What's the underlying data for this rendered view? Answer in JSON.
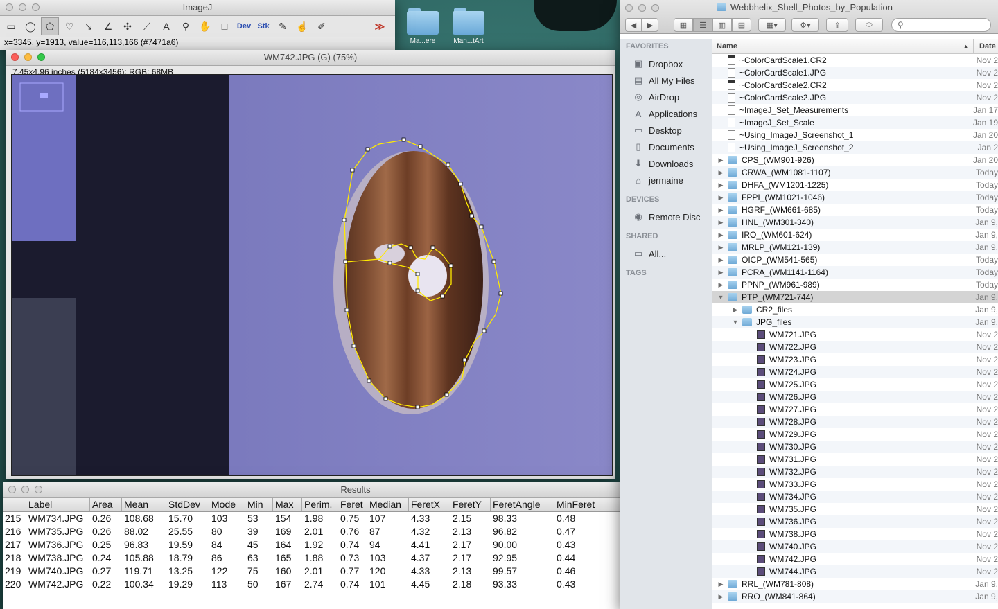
{
  "desktop": {
    "icons": [
      {
        "label": "Ma...ere"
      },
      {
        "label": "Man...tArt"
      }
    ]
  },
  "imagej": {
    "title": "ImageJ",
    "tools": [
      {
        "name": "rectangle-tool-icon",
        "glyph": "▭"
      },
      {
        "name": "oval-tool-icon",
        "glyph": "◯"
      },
      {
        "name": "polygon-tool-icon",
        "glyph": "⬠"
      },
      {
        "name": "freehand-tool-icon",
        "glyph": "♡"
      },
      {
        "name": "line-tool-icon",
        "glyph": "↘"
      },
      {
        "name": "angle-tool-icon",
        "glyph": "∠"
      },
      {
        "name": "point-tool-icon",
        "glyph": "✣"
      },
      {
        "name": "wand-tool-icon",
        "glyph": "⟋"
      },
      {
        "name": "text-tool-icon",
        "glyph": "A"
      },
      {
        "name": "magnifier-tool-icon",
        "glyph": "⚲"
      },
      {
        "name": "hand-tool-icon",
        "glyph": "✋"
      },
      {
        "name": "color-picker-tool-icon",
        "glyph": "□"
      },
      {
        "name": "dev-menu",
        "glyph": "Dev"
      },
      {
        "name": "stk-menu",
        "glyph": "Stk"
      },
      {
        "name": "brush-tool-icon",
        "glyph": "✎"
      },
      {
        "name": "flood-fill-tool-icon",
        "glyph": "☝"
      },
      {
        "name": "pencil-tool-icon",
        "glyph": "✐"
      },
      {
        "name": "blank-tool-1",
        "glyph": ""
      },
      {
        "name": "blank-tool-2",
        "glyph": ""
      },
      {
        "name": "more-tools-icon",
        "glyph": "≫"
      }
    ],
    "status": "x=3345, y=1913, value=116,113,166 (#7471a6)"
  },
  "image_window": {
    "title": "WM742.JPG (G) (75%)",
    "info": "7.45x4.96 inches (5184x3456); RGB; 68MB"
  },
  "results": {
    "title": "Results",
    "columns": [
      "",
      "Label",
      "Area",
      "Mean",
      "StdDev",
      "Mode",
      "Min",
      "Max",
      "Perim.",
      "Feret",
      "Median",
      "FeretX",
      "FeretY",
      "FeretAngle",
      "MinFeret"
    ],
    "rows": [
      [
        "215",
        "WM734.JPG",
        "0.26",
        "108.68",
        "15.70",
        "103",
        "53",
        "154",
        "1.98",
        "0.75",
        "107",
        "4.33",
        "2.15",
        "98.33",
        "0.48"
      ],
      [
        "216",
        "WM735.JPG",
        "0.26",
        "88.02",
        "25.55",
        "80",
        "39",
        "169",
        "2.01",
        "0.76",
        "87",
        "4.32",
        "2.13",
        "96.82",
        "0.47"
      ],
      [
        "217",
        "WM736.JPG",
        "0.25",
        "96.83",
        "19.59",
        "84",
        "45",
        "164",
        "1.92",
        "0.74",
        "94",
        "4.41",
        "2.17",
        "90.00",
        "0.43"
      ],
      [
        "218",
        "WM738.JPG",
        "0.24",
        "105.88",
        "18.79",
        "86",
        "63",
        "165",
        "1.88",
        "0.73",
        "103",
        "4.37",
        "2.17",
        "92.95",
        "0.44"
      ],
      [
        "219",
        "WM740.JPG",
        "0.27",
        "119.71",
        "13.25",
        "122",
        "75",
        "160",
        "2.01",
        "0.77",
        "120",
        "4.33",
        "2.13",
        "99.57",
        "0.46"
      ],
      [
        "220",
        "WM742.JPG",
        "0.22",
        "100.34",
        "19.29",
        "113",
        "50",
        "167",
        "2.74",
        "0.74",
        "101",
        "4.45",
        "2.18",
        "93.33",
        "0.43"
      ]
    ]
  },
  "finder": {
    "title": "Webbhelix_Shell_Photos_by_Population",
    "search_placeholder": "",
    "sidebar": [
      {
        "type": "header",
        "label": "FAVORITES"
      },
      {
        "type": "item",
        "label": "Dropbox",
        "icon": "dropbox-icon",
        "glyph": "▣"
      },
      {
        "type": "item",
        "label": "All My Files",
        "icon": "all-files-icon",
        "glyph": "▤"
      },
      {
        "type": "item",
        "label": "AirDrop",
        "icon": "airdrop-icon",
        "glyph": "◎"
      },
      {
        "type": "item",
        "label": "Applications",
        "icon": "applications-icon",
        "glyph": "A"
      },
      {
        "type": "item",
        "label": "Desktop",
        "icon": "desktop-icon",
        "glyph": "▭"
      },
      {
        "type": "item",
        "label": "Documents",
        "icon": "documents-icon",
        "glyph": "▯"
      },
      {
        "type": "item",
        "label": "Downloads",
        "icon": "downloads-icon",
        "glyph": "⬇"
      },
      {
        "type": "item",
        "label": "jermaine",
        "icon": "home-icon",
        "glyph": "⌂"
      },
      {
        "type": "header",
        "label": "DEVICES"
      },
      {
        "type": "item",
        "label": "Remote Disc",
        "icon": "remote-disc-icon",
        "glyph": "◉"
      },
      {
        "type": "header",
        "label": "SHARED"
      },
      {
        "type": "item",
        "label": "All...",
        "icon": "network-icon",
        "glyph": "▭"
      },
      {
        "type": "header",
        "label": "TAGS"
      }
    ],
    "columns": {
      "name": "Name",
      "date": "Date"
    },
    "rows": [
      {
        "name": "~ColorCardScale1.CR2",
        "date": "Nov 2",
        "kind": "cr2",
        "level": 0,
        "tri": ""
      },
      {
        "name": "~ColorCardScale1.JPG",
        "date": "Nov 2",
        "kind": "doc",
        "level": 0,
        "tri": ""
      },
      {
        "name": "~ColorCardScale2.CR2",
        "date": "Nov 2",
        "kind": "cr2",
        "level": 0,
        "tri": ""
      },
      {
        "name": "~ColorCardScale2.JPG",
        "date": "Nov 2",
        "kind": "doc",
        "level": 0,
        "tri": ""
      },
      {
        "name": "~ImageJ_Set_Measurements",
        "date": "Jan 17",
        "kind": "doc",
        "level": 0,
        "tri": ""
      },
      {
        "name": "~ImageJ_Set_Scale",
        "date": "Jan 19",
        "kind": "doc",
        "level": 0,
        "tri": ""
      },
      {
        "name": "~Using_ImageJ_Screenshot_1",
        "date": "Jan 20",
        "kind": "doc",
        "level": 0,
        "tri": ""
      },
      {
        "name": "~Using_ImageJ_Screenshot_2",
        "date": "Jan 2",
        "kind": "doc",
        "level": 0,
        "tri": ""
      },
      {
        "name": "CPS_(WM901-926)",
        "date": "Jan 20",
        "kind": "folder",
        "level": 0,
        "tri": "▶"
      },
      {
        "name": "CRWA_(WM1081-1107)",
        "date": "Today",
        "kind": "folder",
        "level": 0,
        "tri": "▶"
      },
      {
        "name": "DHFA_(WM1201-1225)",
        "date": "Today",
        "kind": "folder",
        "level": 0,
        "tri": "▶"
      },
      {
        "name": "FPPI_(WM1021-1046)",
        "date": "Today",
        "kind": "folder",
        "level": 0,
        "tri": "▶"
      },
      {
        "name": "HGRF_(WM661-685)",
        "date": "Today",
        "kind": "folder",
        "level": 0,
        "tri": "▶"
      },
      {
        "name": "HNL_(WM301-340)",
        "date": "Jan 9,",
        "kind": "folder",
        "level": 0,
        "tri": "▶"
      },
      {
        "name": "IRO_(WM601-624)",
        "date": "Jan 9,",
        "kind": "folder",
        "level": 0,
        "tri": "▶"
      },
      {
        "name": "MRLP_(WM121-139)",
        "date": "Jan 9,",
        "kind": "folder",
        "level": 0,
        "tri": "▶"
      },
      {
        "name": "OICP_(WM541-565)",
        "date": "Today",
        "kind": "folder",
        "level": 0,
        "tri": "▶"
      },
      {
        "name": "PCRA_(WM1141-1164)",
        "date": "Today",
        "kind": "folder",
        "level": 0,
        "tri": "▶"
      },
      {
        "name": "PPNP_(WM961-989)",
        "date": "Today",
        "kind": "folder",
        "level": 0,
        "tri": "▶"
      },
      {
        "name": "PTP_(WM721-744)",
        "date": "Jan 9,",
        "kind": "folder",
        "level": 0,
        "tri": "▼",
        "selected": true
      },
      {
        "name": "CR2_files",
        "date": "Jan 9,",
        "kind": "folder",
        "level": 1,
        "tri": "▶"
      },
      {
        "name": "JPG_files",
        "date": "Jan 9,",
        "kind": "folder",
        "level": 1,
        "tri": "▼"
      },
      {
        "name": "WM721.JPG",
        "date": "Nov 2",
        "kind": "img",
        "level": 2,
        "tri": ""
      },
      {
        "name": "WM722.JPG",
        "date": "Nov 2",
        "kind": "img",
        "level": 2,
        "tri": ""
      },
      {
        "name": "WM723.JPG",
        "date": "Nov 2",
        "kind": "img",
        "level": 2,
        "tri": ""
      },
      {
        "name": "WM724.JPG",
        "date": "Nov 2",
        "kind": "img",
        "level": 2,
        "tri": ""
      },
      {
        "name": "WM725.JPG",
        "date": "Nov 2",
        "kind": "img",
        "level": 2,
        "tri": ""
      },
      {
        "name": "WM726.JPG",
        "date": "Nov 2",
        "kind": "img",
        "level": 2,
        "tri": ""
      },
      {
        "name": "WM727.JPG",
        "date": "Nov 2",
        "kind": "img",
        "level": 2,
        "tri": ""
      },
      {
        "name": "WM728.JPG",
        "date": "Nov 2",
        "kind": "img",
        "level": 2,
        "tri": ""
      },
      {
        "name": "WM729.JPG",
        "date": "Nov 2",
        "kind": "img",
        "level": 2,
        "tri": ""
      },
      {
        "name": "WM730.JPG",
        "date": "Nov 2",
        "kind": "img",
        "level": 2,
        "tri": ""
      },
      {
        "name": "WM731.JPG",
        "date": "Nov 2",
        "kind": "img",
        "level": 2,
        "tri": ""
      },
      {
        "name": "WM732.JPG",
        "date": "Nov 2",
        "kind": "img",
        "level": 2,
        "tri": ""
      },
      {
        "name": "WM733.JPG",
        "date": "Nov 2",
        "kind": "img",
        "level": 2,
        "tri": ""
      },
      {
        "name": "WM734.JPG",
        "date": "Nov 2",
        "kind": "img",
        "level": 2,
        "tri": ""
      },
      {
        "name": "WM735.JPG",
        "date": "Nov 2",
        "kind": "img",
        "level": 2,
        "tri": ""
      },
      {
        "name": "WM736.JPG",
        "date": "Nov 2",
        "kind": "img",
        "level": 2,
        "tri": ""
      },
      {
        "name": "WM738.JPG",
        "date": "Nov 2",
        "kind": "img",
        "level": 2,
        "tri": ""
      },
      {
        "name": "WM740.JPG",
        "date": "Nov 2",
        "kind": "img",
        "level": 2,
        "tri": ""
      },
      {
        "name": "WM742.JPG",
        "date": "Nov 2",
        "kind": "img",
        "level": 2,
        "tri": ""
      },
      {
        "name": "WM744.JPG",
        "date": "Nov 2",
        "kind": "img",
        "level": 2,
        "tri": ""
      },
      {
        "name": "RRL_(WM781-808)",
        "date": "Jan 9,",
        "kind": "folder",
        "level": 0,
        "tri": "▶"
      },
      {
        "name": "RRO_(WM841-864)",
        "date": "Jan 9,",
        "kind": "folder",
        "level": 0,
        "tri": "▶"
      }
    ]
  }
}
